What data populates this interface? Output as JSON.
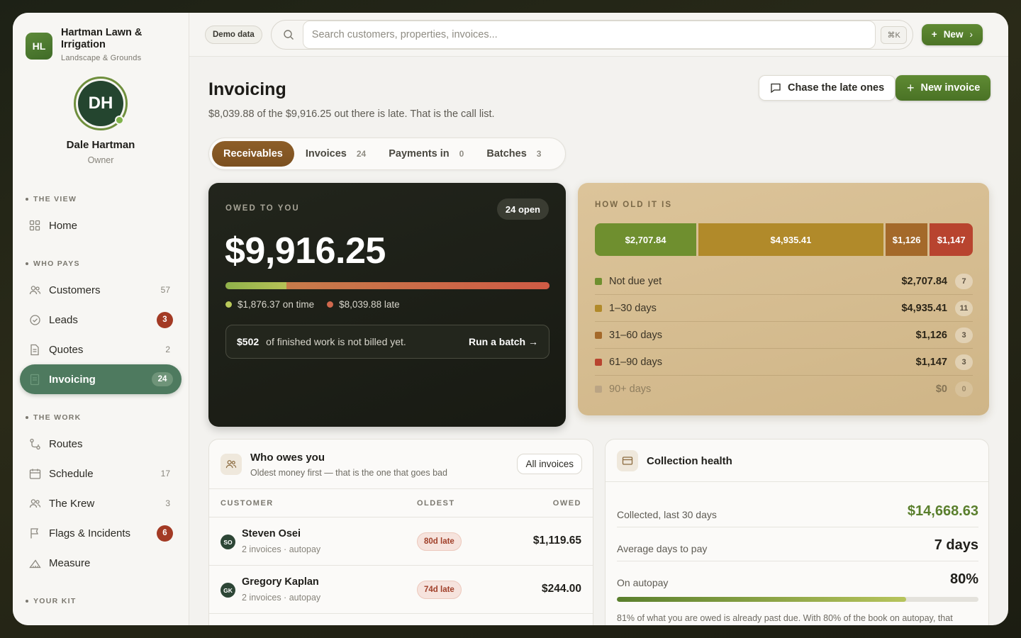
{
  "brand": {
    "initials": "HL",
    "name": "Hartman Lawn & Irrigation",
    "tagline": "Landscape & Grounds"
  },
  "profile": {
    "initials": "DH",
    "name": "Dale Hartman",
    "role": "Owner"
  },
  "nav": {
    "sections": [
      {
        "title": "THE VIEW",
        "items": [
          {
            "label": "Home",
            "icon": "home-grid-icon",
            "count": ""
          }
        ]
      },
      {
        "title": "WHO PAYS",
        "items": [
          {
            "label": "Customers",
            "icon": "users-icon",
            "count": "57"
          },
          {
            "label": "Leads",
            "icon": "check-circle-icon",
            "count": "3"
          },
          {
            "label": "Quotes",
            "icon": "document-icon",
            "count": "2"
          },
          {
            "label": "Invoicing",
            "icon": "invoice-icon",
            "count": "24"
          }
        ]
      },
      {
        "title": "THE WORK",
        "items": [
          {
            "label": "Routes",
            "icon": "route-icon",
            "count": ""
          },
          {
            "label": "Schedule",
            "icon": "calendar-icon",
            "count": "17"
          },
          {
            "label": "The Krew",
            "icon": "users-icon",
            "count": "3"
          },
          {
            "label": "Flags & Incidents",
            "icon": "flag-icon",
            "count": "6"
          },
          {
            "label": "Measure",
            "icon": "measure-icon",
            "count": ""
          }
        ]
      },
      {
        "title": "YOUR KIT",
        "items": []
      }
    ]
  },
  "topbar": {
    "demo_label": "Demo data",
    "search_placeholder": "Search customers, properties, invoices...",
    "shortcut": "⌘K",
    "new_label": "New"
  },
  "page": {
    "title": "Invoicing",
    "subtitle": "$8,039.88 of the $9,916.25 out there is late. That is the call list.",
    "chase_label": "Chase the late ones",
    "new_invoice_label": "New invoice"
  },
  "tabs": [
    {
      "label": "Receivables",
      "count": ""
    },
    {
      "label": "Invoices",
      "count": "24"
    },
    {
      "label": "Payments in",
      "count": "0"
    },
    {
      "label": "Batches",
      "count": "3"
    }
  ],
  "owed": {
    "label": "OWED TO YOU",
    "open_chip": "24 open",
    "amount": "$9,916.25",
    "ontime_fraction": 0.189,
    "ontime_label": "$1,876.37 on time",
    "late_label": "$8,039.88 late",
    "colors": {
      "ontime": "#a5bb52",
      "late": "#cf5b45"
    },
    "unbilled_amount": "$502",
    "unbilled_text": "of finished work is not billed yet.",
    "run_label": "Run a batch →"
  },
  "aging": {
    "label": "HOW OLD IT IS",
    "buckets": [
      {
        "label": "Not due yet",
        "amount": "$2,707.84",
        "bar_label": "$2,707.84",
        "value": 2707.84,
        "count": "7",
        "color": "#6f8f2f"
      },
      {
        "label": "1–30 days",
        "amount": "$4,935.41",
        "bar_label": "$4,935.41",
        "value": 4935.41,
        "count": "11",
        "color": "#b18a2a"
      },
      {
        "label": "31–60 days",
        "amount": "$1,126",
        "bar_label": "$1,126",
        "value": 1126,
        "count": "3",
        "color": "#a4692a"
      },
      {
        "label": "61–90 days",
        "amount": "$1,147",
        "bar_label": "$1,147",
        "value": 1147,
        "count": "3",
        "color": "#b8442f"
      },
      {
        "label": "90+ days",
        "amount": "$0",
        "bar_label": "",
        "value": 0,
        "count": "0",
        "color": "#9c8a78"
      }
    ]
  },
  "owes": {
    "title": "Who owes you",
    "subtitle": "Oldest money first — that is the one that goes bad",
    "all_label": "All invoices",
    "columns": {
      "customer": "CUSTOMER",
      "oldest": "OLDEST",
      "owed": "OWED"
    },
    "rows": [
      {
        "initials": "SO",
        "name": "Steven Osei",
        "meta": "2 invoices · autopay",
        "late": "80d late",
        "owed": "$1,119.65"
      },
      {
        "initials": "GK",
        "name": "Gregory Kaplan",
        "meta": "2 invoices · autopay",
        "late": "74d late",
        "owed": "$244.00"
      }
    ]
  },
  "health": {
    "title": "Collection health",
    "rows": [
      {
        "label": "Collected, last 30 days",
        "value": "$14,668.63"
      },
      {
        "label": "Average days to pay",
        "value": "7 days"
      },
      {
        "label": "On autopay",
        "value": "80%"
      }
    ],
    "autopay_fraction": 0.8,
    "note": "81% of what you are owed is already past due. With 80% of the book on autopay, that"
  }
}
